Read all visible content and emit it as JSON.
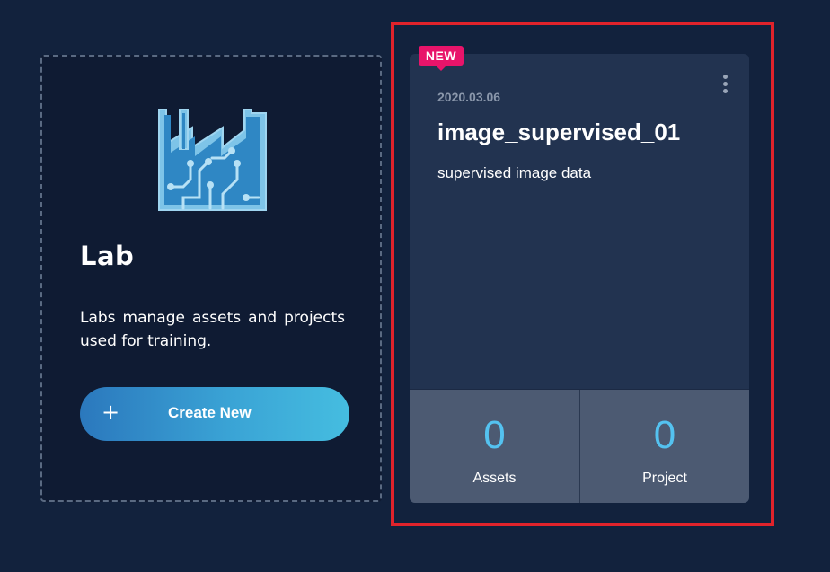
{
  "create_card": {
    "icon": "lab-factory-icon",
    "title": "Lab",
    "description": "Labs manage assets and projects used for training.",
    "button": {
      "icon": "plus-icon",
      "icon_glyph": "+",
      "label": "Create New"
    }
  },
  "lab_item": {
    "badge": "NEW",
    "date": "2020.03.06",
    "title": "image_supervised_01",
    "description": "supervised image data",
    "menu_icon": "more-vertical-icon",
    "stats": [
      {
        "count": "0",
        "label": "Assets"
      },
      {
        "count": "0",
        "label": "Project"
      }
    ]
  },
  "colors": {
    "background": "#12223d",
    "card_background": "#223350",
    "stats_background": "#4c5a72",
    "accent": "#54c2f0",
    "badge": "#e8146a",
    "selection": "#e0232b",
    "button_gradient_start": "#2b78bd",
    "button_gradient_end": "#45bde0"
  }
}
